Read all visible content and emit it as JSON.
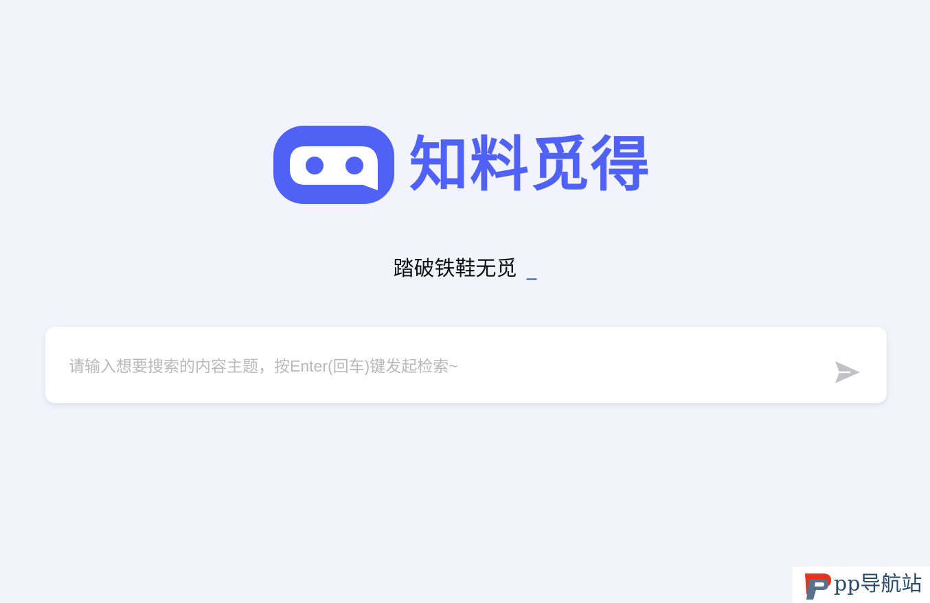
{
  "brand": {
    "name": "知料觅得",
    "color": "#4f62f5"
  },
  "slogan": {
    "text": "踏破铁鞋无觅",
    "cursor": "_",
    "cursor_color": "#4a86e8"
  },
  "search": {
    "placeholder": "请输入想要搜索的内容主题，按Enter(回车)键发起检索~",
    "value": "",
    "send_icon": "send-icon"
  },
  "watermark": {
    "text": "pp导航站",
    "icon": "pp-logo-icon"
  },
  "colors": {
    "background": "#f3f4fb",
    "accent": "#4f62f5",
    "placeholder": "#b8b8be"
  }
}
